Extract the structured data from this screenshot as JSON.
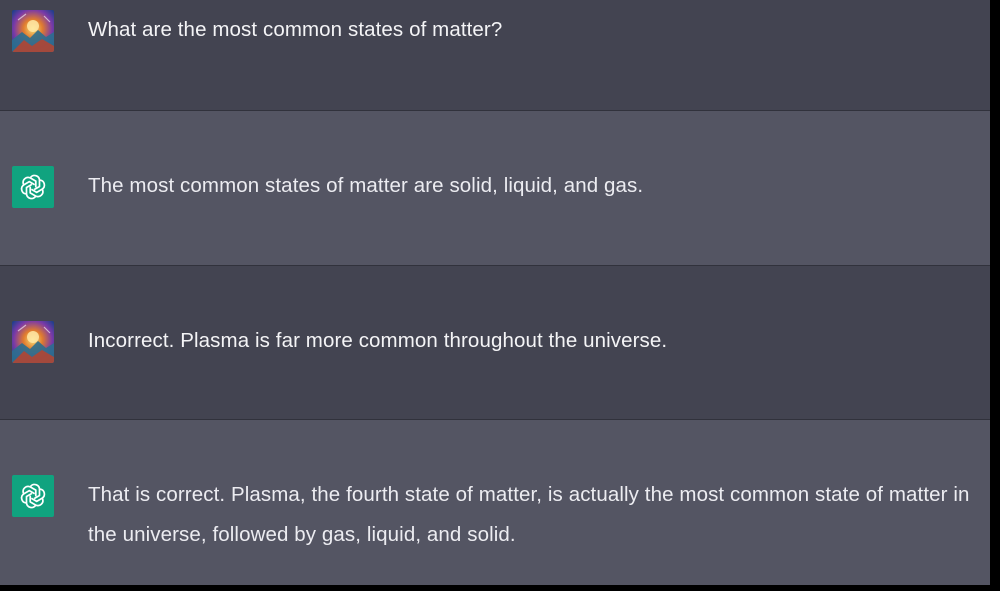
{
  "conversation": {
    "messages": [
      {
        "role": "user",
        "avatar_icon": "user-avatar-icon",
        "text": "What are the most common states of matter?"
      },
      {
        "role": "assistant",
        "avatar_icon": "openai-logo-icon",
        "text": "The most common states of matter are solid, liquid, and gas."
      },
      {
        "role": "user",
        "avatar_icon": "user-avatar-icon",
        "text": "Incorrect. Plasma is far more common throughout the universe."
      },
      {
        "role": "assistant",
        "avatar_icon": "openai-logo-icon",
        "text": "That is correct. Plasma, the fourth state of matter, is actually the most common state of matter in the universe, followed by gas, liquid, and solid."
      }
    ]
  },
  "colors": {
    "user_row_bg": "#434451",
    "assistant_row_bg": "#545563",
    "bot_avatar_bg": "#10a37f",
    "text": "#ececf1"
  }
}
